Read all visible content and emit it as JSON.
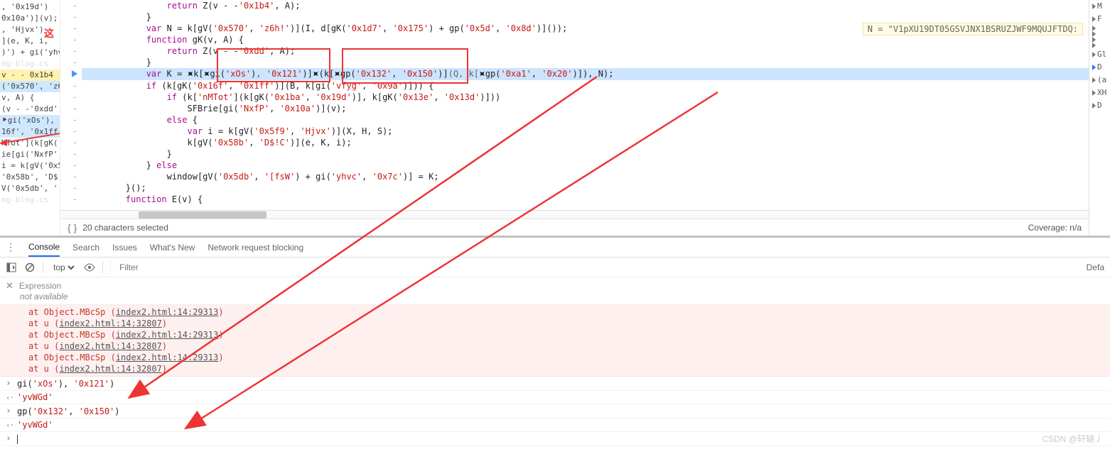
{
  "left_code_fragments": [
    {
      "t": ", '0x19d')"
    },
    {
      "t": "0x10a')](v);"
    },
    {
      "t": ""
    },
    {
      "t": ", 'Hjvx')"
    },
    {
      "t": "](e, K, i,"
    },
    {
      "t": ""
    },
    {
      "t": ""
    },
    {
      "t": ")') + gi('yhvc"
    },
    {
      "t": ""
    },
    {
      "t": "mg-blog.cs",
      "cls": "wm"
    },
    {
      "t": ""
    },
    {
      "t": "v - - 0x1b4 ,",
      "cls": "hl2"
    },
    {
      "t": "('0x570', 'z6!",
      "cls": "hl"
    },
    {
      "t": "v, A) {"
    },
    {
      "t": "(v - -'0xdd', A"
    },
    {
      "t": ""
    },
    {
      "t": "⯈gi('xOs'), '0x",
      "cls": "hl"
    },
    {
      "t": "16f', '0x1ff')",
      "cls": "hl"
    },
    {
      "t": "MTot'](k[gK('0x"
    },
    {
      "t": "ie[gi('NxfP',"
    },
    {
      "t": ""
    },
    {
      "t": "i = k[gV('0x5f"
    },
    {
      "t": "'0x58b', 'D$!C"
    },
    {
      "t": ""
    },
    {
      "t": ""
    },
    {
      "t": "V('0x5db', '[fs"
    },
    {
      "t": ""
    },
    {
      "t": "mg-blog.cs",
      "cls": "wm"
    }
  ],
  "annot_text": "这",
  "code": [
    {
      "indent": 16,
      "text": "<span class='kw'>return</span> Z(v - -<span class='str'>'0x1b4'</span>, A);"
    },
    {
      "indent": 12,
      "text": "}"
    },
    {
      "indent": 12,
      "text": "<span class='kw'>var</span> N = k[gV(<span class='str'>'0x570'</span>, <span class='str'>'z6h!'</span>)](I, d[gK(<span class='str'>'0x1d7'</span>, <span class='str'>'0x175'</span>) + gp(<span class='str'>'0x5d'</span>, <span class='str'>'0x8d'</span>)]());"
    },
    {
      "indent": 12,
      "text": "<span class='kw'>function</span> gK(v, A) {"
    },
    {
      "indent": 16,
      "text": "<span class='kw'>return</span> Z(v - -<span class='str'>'0xdd'</span>, A);"
    },
    {
      "indent": 12,
      "text": "}"
    },
    {
      "indent": 12,
      "text": "<span class='kw'>var</span> K = <span style='background:#cde4ff'>⯍</span>k[<span style='background:#cde4ff'>⯍</span>gi(<span class='str'>'xOs'</span>)<span class='op'>,</span> <span class='str'>'0x121'</span>)]<span style='background:#cde4ff'>⯍</span>(<span style='background:#cde4ff'>k</span>[<span style='background:#cde4ff'>⯍</span>gp(<span class='str'>'0x132'</span>, <span class='str'>'0x150'</span>)]<span class='op'>(Q, k[</span><span style='background:#cde4ff'>⯍</span>gp(<span class='str'>'0xa1'</span>, <span class='str'>'0x20'</span>)]), N);",
      "exec": true
    },
    {
      "indent": 12,
      "text": "<span class='kw'>if</span> (k[gK(<span class='str'>'0x16f'</span>, <span class='str'>'0x1ff'</span>)](B, k[gi(<span class='str'>'vfyg'</span>, <span class='str'>'0x9a'</span>)])) {"
    },
    {
      "indent": 16,
      "text": "<span class='kw'>if</span> (k[<span class='str'>'nMTot'</span>](k[gK(<span class='str'>'0x1ba'</span>, <span class='str'>'0x19d'</span>)], k[gK(<span class='str'>'0x13e'</span>, <span class='str'>'0x13d'</span>)]))"
    },
    {
      "indent": 20,
      "text": "SFBrie[gi(<span class='str'>'NxfP'</span>, <span class='str'>'0x10a'</span>)](v);"
    },
    {
      "indent": 16,
      "text": "<span class='kw'>else</span> {"
    },
    {
      "indent": 20,
      "text": "<span class='kw'>var</span> i = k[gV(<span class='str'>'0x5f9'</span>, <span class='str'>'Hjvx'</span>)](X, H, S);"
    },
    {
      "indent": 20,
      "text": "k[gV(<span class='str'>'0x58b'</span>, <span class='str'>'D$!C'</span>)](e, K, i);"
    },
    {
      "indent": 16,
      "text": "}"
    },
    {
      "indent": 12,
      "text": "} <span class='kw'>else</span>"
    },
    {
      "indent": 16,
      "text": "window[gV(<span class='str'>'0x5db'</span>, <span class='str'>'[fsW'</span>) + gi(<span class='str'>'yhvc'</span>, <span class='str'>'0x7c'</span>)] = K;"
    },
    {
      "indent": 8,
      "text": "}();"
    },
    {
      "indent": 8,
      "text": "<span class='kw'>function</span> E(v) {"
    }
  ],
  "hint_text": "N = \"V1pXU19DT05GSVJNX1BSRUZJWF9MQUJFTDQ:",
  "selection_status": "20 characters selected",
  "coverage_status": "Coverage: n/a",
  "right_items": [
    "M",
    "F",
    "",
    "",
    "",
    "",
    "Gl",
    "D",
    "(a",
    "XH",
    "D"
  ],
  "tabs": {
    "console": "Console",
    "search": "Search",
    "issues": "Issues",
    "whatsnew": "What's New",
    "netblock": "Network request blocking"
  },
  "toolbar": {
    "context": "top",
    "filter_placeholder": "Filter",
    "right": "Defa"
  },
  "eager": {
    "label": "Expression",
    "msg": "not available"
  },
  "errors": [
    "at Object.MBcSp (<span class='link'>index2.html:14:29313</span>)",
    "at u (<span class='link'>index2.html:14:32807</span>)",
    "at Object.MBcSp (<span class='link'>index2.html:14:29313</span>)",
    "at u (<span class='link'>index2.html:14:32807</span>)",
    "at Object.MBcSp (<span class='link'>index2.html:14:29313</span>)",
    "at u (<span class='link'>index2.html:14:32807</span>)"
  ],
  "console_rows": [
    {
      "type": "in",
      "html": "gi(<span class='str'>'xOs'</span>), <span class='str'>'0x121'</span>)"
    },
    {
      "type": "out",
      "html": "<span class='str'>'yvWGd'</span>"
    },
    {
      "type": "in",
      "html": "gp(<span class='str'>'0x132'</span>, <span class='str'>'0x150'</span>)"
    },
    {
      "type": "out",
      "html": "<span class='str'>'yvWGd'</span>"
    }
  ],
  "watermark": "CSDN @轩辕丿"
}
